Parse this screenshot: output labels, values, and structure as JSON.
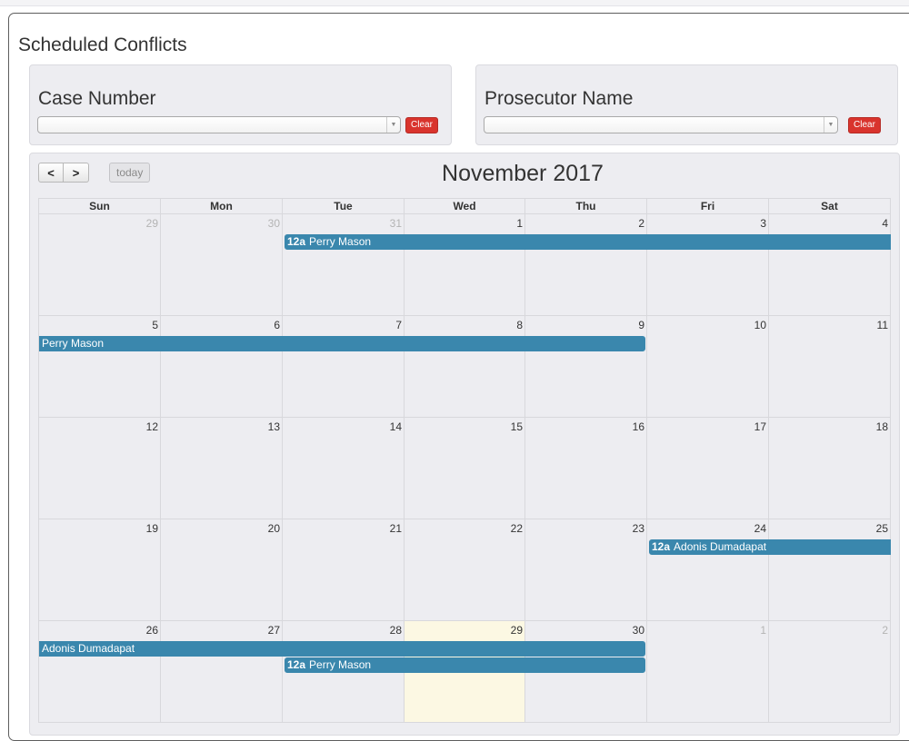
{
  "page": {
    "title": "Scheduled Conflicts"
  },
  "filters": {
    "case": {
      "label": "Case Number",
      "value": "",
      "clear_label": "Clear"
    },
    "prosecutor": {
      "label": "Prosecutor Name",
      "value": "",
      "clear_label": "Clear"
    }
  },
  "calendar": {
    "title": "November 2017",
    "prev_label": "<",
    "next_label": ">",
    "today_label": "today",
    "weekdays": [
      "Sun",
      "Mon",
      "Tue",
      "Wed",
      "Thu",
      "Fri",
      "Sat"
    ],
    "today_date": "29",
    "weeks": [
      {
        "days": [
          {
            "num": "29",
            "other": true
          },
          {
            "num": "30",
            "other": true
          },
          {
            "num": "31",
            "other": true
          },
          {
            "num": "1"
          },
          {
            "num": "2"
          },
          {
            "num": "3"
          },
          {
            "num": "4"
          }
        ],
        "events": [
          {
            "time": "12a",
            "title": "Perry Mason",
            "start": 2,
            "end": 6,
            "row": 0,
            "starts_here": true,
            "ends_here": false
          }
        ]
      },
      {
        "days": [
          {
            "num": "5"
          },
          {
            "num": "6"
          },
          {
            "num": "7"
          },
          {
            "num": "8"
          },
          {
            "num": "9"
          },
          {
            "num": "10"
          },
          {
            "num": "11"
          }
        ],
        "events": [
          {
            "time": "",
            "title": "Perry Mason",
            "start": 0,
            "end": 4,
            "row": 0,
            "starts_here": false,
            "ends_here": true
          }
        ]
      },
      {
        "days": [
          {
            "num": "12"
          },
          {
            "num": "13"
          },
          {
            "num": "14"
          },
          {
            "num": "15"
          },
          {
            "num": "16"
          },
          {
            "num": "17"
          },
          {
            "num": "18"
          }
        ],
        "events": []
      },
      {
        "days": [
          {
            "num": "19"
          },
          {
            "num": "20"
          },
          {
            "num": "21"
          },
          {
            "num": "22"
          },
          {
            "num": "23"
          },
          {
            "num": "24"
          },
          {
            "num": "25"
          }
        ],
        "events": [
          {
            "time": "12a",
            "title": "Adonis Dumadapat",
            "start": 5,
            "end": 6,
            "row": 0,
            "starts_here": true,
            "ends_here": false
          }
        ]
      },
      {
        "days": [
          {
            "num": "26"
          },
          {
            "num": "27"
          },
          {
            "num": "28"
          },
          {
            "num": "29",
            "today": true
          },
          {
            "num": "30"
          },
          {
            "num": "1",
            "other": true
          },
          {
            "num": "2",
            "other": true
          }
        ],
        "events": [
          {
            "time": "",
            "title": "Adonis Dumadapat",
            "start": 0,
            "end": 4,
            "row": 0,
            "starts_here": false,
            "ends_here": true
          },
          {
            "time": "12a",
            "title": "Perry Mason",
            "start": 2,
            "end": 4,
            "row": 1,
            "starts_here": true,
            "ends_here": true
          }
        ]
      }
    ]
  }
}
